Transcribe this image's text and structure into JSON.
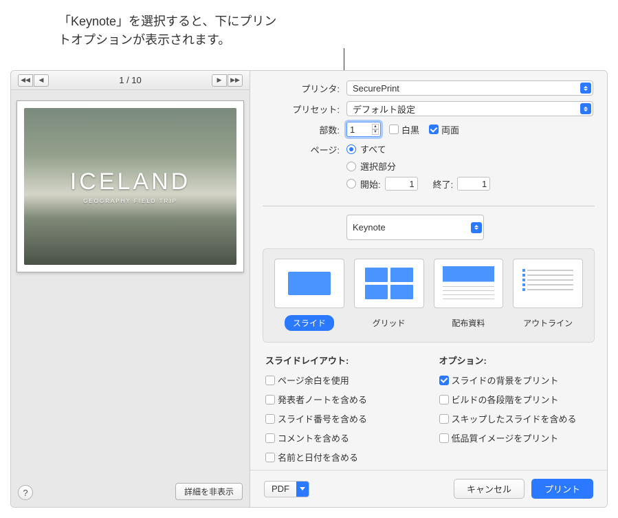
{
  "callout": {
    "text": "「Keynote」を選択すると、下にプリントオプションが表示されます。"
  },
  "nav": {
    "page_indicator": "1 / 10"
  },
  "preview": {
    "slide_title": "ICELAND",
    "slide_subtitle": "GEOGRAPHY FIELD TRIP"
  },
  "labels": {
    "printer": "プリンタ:",
    "preset": "プリセット:",
    "copies": "部数:",
    "pages": "ページ:",
    "bw": "白黒",
    "duplex": "両面",
    "all": "すべて",
    "selection": "選択部分",
    "from": "開始:",
    "to": "終了:",
    "slide_layout": "スライドレイアウト:",
    "options": "オプション:",
    "hide_details": "詳細を非表示"
  },
  "values": {
    "printer": "SecurePrint",
    "preset": "デフォルト設定",
    "copies": "1",
    "from": "1",
    "to": "1",
    "app_menu": "Keynote"
  },
  "layout_modes": {
    "slide": "スライド",
    "grid": "グリッド",
    "handout": "配布資料",
    "outline": "アウトライン"
  },
  "slide_layout_opts": {
    "margins": "ページ余白を使用",
    "notes": "発表者ノートを含める",
    "numbers": "スライド番号を含める",
    "comments": "コメントを含める",
    "name_date": "名前と日付を含める"
  },
  "print_opts": {
    "background": "スライドの背景をプリント",
    "builds": "ビルドの各段階をプリント",
    "skipped": "スキップしたスライドを含める",
    "lowres": "低品質イメージをプリント"
  },
  "footer": {
    "pdf": "PDF",
    "cancel": "キャンセル",
    "print": "プリント"
  }
}
